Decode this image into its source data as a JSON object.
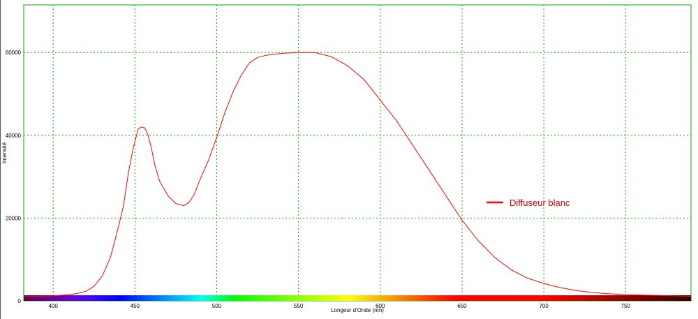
{
  "chart_data": {
    "type": "line",
    "ylabel": "Intensité",
    "xlabel": "Longeur d'Onde (nm)",
    "xlim": [
      382,
      790
    ],
    "ylim": [
      0,
      71500
    ],
    "x_ticks": [
      400,
      450,
      500,
      550,
      600,
      650,
      700,
      750
    ],
    "y_ticks": [
      0,
      20000,
      40000,
      60000
    ],
    "grid": true,
    "legend_position": "right",
    "colors": {
      "series": "#ff0000",
      "grid": "#00b000",
      "frame": "#00b000",
      "legend_text": "#d40000"
    },
    "series": [
      {
        "name": "Diffuseur blanc",
        "x": [
          382,
          390,
          400,
          410,
          415,
          420,
          425,
          430,
          435,
          440,
          443,
          446,
          449,
          452,
          454,
          456,
          458,
          460,
          462,
          465,
          470,
          475,
          480,
          483,
          486,
          490,
          495,
          500,
          505,
          510,
          515,
          520,
          525,
          530,
          540,
          550,
          560,
          570,
          580,
          590,
          600,
          610,
          620,
          630,
          640,
          650,
          660,
          670,
          680,
          690,
          700,
          710,
          720,
          730,
          740,
          750,
          760,
          770,
          780,
          790
        ],
        "y": [
          1000,
          1100,
          1200,
          1500,
          1800,
          2300,
          3500,
          6000,
          10500,
          18000,
          23000,
          31000,
          37000,
          41500,
          42000,
          41800,
          40000,
          37000,
          33000,
          29000,
          25500,
          23500,
          23000,
          23800,
          25500,
          29500,
          34000,
          39500,
          45500,
          50500,
          54500,
          57500,
          58800,
          59300,
          59800,
          60000,
          60000,
          59000,
          56800,
          53500,
          48500,
          43500,
          37500,
          31500,
          25500,
          19500,
          14500,
          10500,
          7500,
          5500,
          4200,
          3200,
          2500,
          2000,
          1700,
          1500,
          1400,
          1300,
          1200,
          1100
        ]
      }
    ]
  }
}
